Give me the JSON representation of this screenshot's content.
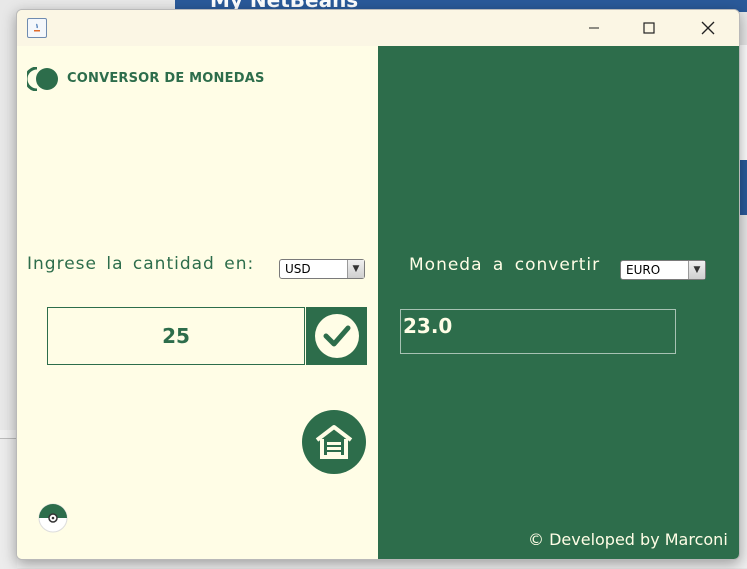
{
  "background": {
    "ide_title": "My NetBeans"
  },
  "window": {
    "controls": {
      "minimize_icon": "minimize-icon",
      "maximize_icon": "maximize-icon",
      "close_icon": "close-icon"
    }
  },
  "header": {
    "title": "CONVERSOR DE MONEDAS"
  },
  "input_section": {
    "label": "Ingrese la cantidad en:",
    "from_currency": "USD",
    "amount": "25"
  },
  "output_section": {
    "label": "Moneda a convertir",
    "to_currency": "EURO",
    "result": "23.0"
  },
  "footer": {
    "credits": "© Developed by Marconi"
  },
  "colors": {
    "primary": "#2d6d4b",
    "background": "#fffde6"
  }
}
